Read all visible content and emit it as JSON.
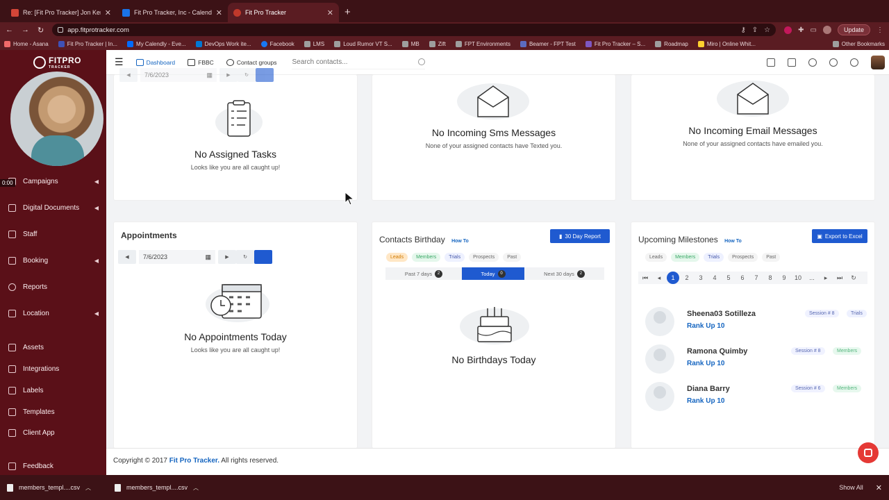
{
  "browser": {
    "tabs": [
      {
        "title": "Re: [Fit Pro Tracker] Jon Kend",
        "favicon_color": "#d44638",
        "active": false
      },
      {
        "title": "Fit Pro Tracker, Inc - Calendar",
        "favicon_color": "#1a73e8",
        "active": false
      },
      {
        "title": "Fit Pro Tracker",
        "favicon_color": "#c0392b",
        "active": true
      }
    ],
    "url": "app.fitprotracker.com",
    "update_label": "Update",
    "bookmarks": [
      "Home - Asana",
      "Fit Pro Tracker | In...",
      "My Calendly - Eve...",
      "DevOps Work ite...",
      "Facebook",
      "LMS",
      "Loud Rumor VT S...",
      "MB",
      "Zift",
      "FPT Environments",
      "Beamer - FPT Test",
      "Fit Pro Tracker – S...",
      "Roadmap",
      "Miro | Online Whit..."
    ],
    "other_bookmarks": "Other Bookmarks"
  },
  "sidebar": {
    "logo": "FITPRO",
    "logo_sub": "TRACKER",
    "timer": "0:00",
    "items": [
      {
        "label": "Campaigns",
        "chevron": true
      },
      {
        "label": "Digital Documents",
        "chevron": true
      },
      {
        "label": "Staff",
        "chevron": false
      },
      {
        "label": "Booking",
        "chevron": true
      },
      {
        "label": "Reports",
        "chevron": false
      },
      {
        "label": "Location",
        "chevron": true
      },
      {
        "label": "Assets",
        "chevron": false
      },
      {
        "label": "Integrations",
        "chevron": false
      },
      {
        "label": "Labels",
        "chevron": false
      },
      {
        "label": "Templates",
        "chevron": false
      },
      {
        "label": "Client App",
        "chevron": false
      },
      {
        "label": "Feedback",
        "chevron": false
      }
    ]
  },
  "header": {
    "nav": [
      "Dashboard",
      "FBBC",
      "Contact groups"
    ],
    "search_placeholder": "Search contacts..."
  },
  "tasks": {
    "date": "7/6/2023",
    "title": "No Assigned Tasks",
    "subtitle": "Looks like you are all caught up!"
  },
  "sms": {
    "title": "No Incoming Sms Messages",
    "subtitle": "None of your assigned contacts have Texted you."
  },
  "email": {
    "title": "No Incoming Email Messages",
    "subtitle": "None of your assigned contacts have emailed you."
  },
  "appointments": {
    "heading": "Appointments",
    "date": "7/6/2023",
    "title": "No Appointments Today",
    "subtitle": "Looks like you are all caught up!"
  },
  "birthdays": {
    "heading": "Contacts Birthday",
    "how_to": "How To",
    "report_button": "30 Day Report",
    "pills": [
      "Leads",
      "Members",
      "Trials",
      "Prospects",
      "Past"
    ],
    "segments": [
      {
        "label": "Past 7 days",
        "count": "2"
      },
      {
        "label": "Today",
        "count": "0"
      },
      {
        "label": "Next 30 days",
        "count": "2"
      }
    ],
    "title": "No Birthdays Today"
  },
  "milestones": {
    "heading": "Upcoming Milestones",
    "how_to": "How To",
    "export_button": "Export to Excel",
    "pills": [
      "Leads",
      "Members",
      "Trials",
      "Prospects",
      "Past"
    ],
    "pages": [
      "1",
      "2",
      "3",
      "4",
      "5",
      "6",
      "7",
      "8",
      "9",
      "10",
      "..."
    ],
    "rows": [
      {
        "name": "Sheena03 Sotilleza",
        "rank": "Rank Up 10",
        "session": "Session # 8",
        "type": "Trials"
      },
      {
        "name": "Ramona Quimby",
        "rank": "Rank Up 10",
        "session": "Session # 8",
        "type": "Members"
      },
      {
        "name": "Diana Barry",
        "rank": "Rank Up 10",
        "session": "Session # 6",
        "type": "Members"
      }
    ]
  },
  "footer": {
    "prefix": "Copyright © 2017 ",
    "brand": "Fit Pro Tracker.",
    "suffix": " All rights reserved."
  },
  "downloads": {
    "files": [
      "members_templ....csv",
      "members_templ....csv"
    ],
    "show_all": "Show All"
  }
}
